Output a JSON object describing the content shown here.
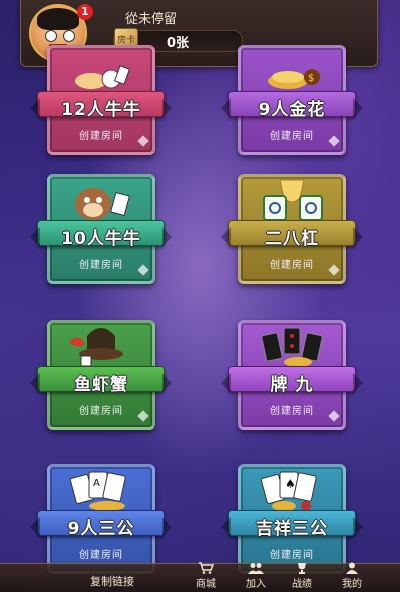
{
  "header": {
    "status": "從未停留",
    "badge": "1",
    "card_icon": "房卡",
    "card_count": "0张"
  },
  "tiles": [
    {
      "name": "12人牛牛",
      "create": "创建房间",
      "theme": "red"
    },
    {
      "name": "9人金花",
      "create": "创建房间",
      "theme": "purple"
    },
    {
      "name": "10人牛牛",
      "create": "创建房间",
      "theme": "green"
    },
    {
      "name": "二八杠",
      "create": "创建房间",
      "theme": "olive"
    },
    {
      "name": "鱼虾蟹",
      "create": "创建房间",
      "theme": "leaf"
    },
    {
      "name": "牌 九",
      "create": "创建房间",
      "theme": "violet"
    },
    {
      "name": "9人三公",
      "create": "创建房间",
      "theme": "blue"
    },
    {
      "name": "吉祥三公",
      "create": "创建房间",
      "theme": "teal"
    }
  ],
  "bottom": {
    "copy_link": "复制链接",
    "shop": "商城",
    "join": "加入",
    "record": "战绩",
    "mine": "我的"
  },
  "icons": {
    "shop": "cart-icon",
    "join": "people-icon",
    "record": "trophy-icon",
    "mine": "user-icon"
  }
}
